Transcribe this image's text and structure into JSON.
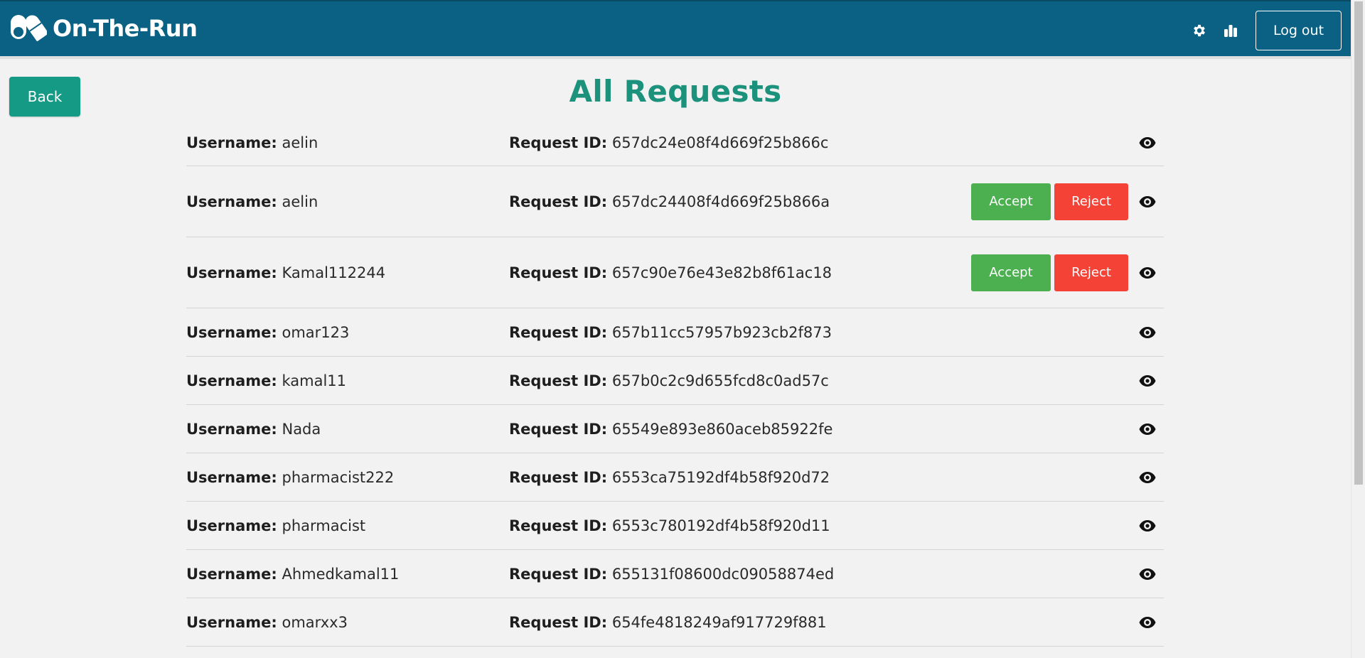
{
  "header": {
    "app_name": "On-The-Run",
    "logout_label": "Log out",
    "settings_icon": "gear-icon",
    "stats_icon": "bar-chart-icon",
    "logo_icon": "pill-capsule-icon"
  },
  "back_label": "Back",
  "page_title": "All Requests",
  "labels": {
    "username": "Username:",
    "request_id": "Request ID:",
    "accept": "Accept",
    "reject": "Reject"
  },
  "requests": [
    {
      "username": "aelin",
      "request_id": "657dc24e08f4d669f25b866c",
      "pending": false
    },
    {
      "username": "aelin",
      "request_id": "657dc24408f4d669f25b866a",
      "pending": true
    },
    {
      "username": "Kamal112244",
      "request_id": "657c90e76e43e82b8f61ac18",
      "pending": true
    },
    {
      "username": "omar123",
      "request_id": "657b11cc57957b923cb2f873",
      "pending": false
    },
    {
      "username": "kamal11",
      "request_id": "657b0c2c9d655fcd8c0ad57c",
      "pending": false
    },
    {
      "username": "Nada",
      "request_id": "65549e893e860aceb85922fe",
      "pending": false
    },
    {
      "username": "pharmacist222",
      "request_id": "6553ca75192df4b58f920d72",
      "pending": false
    },
    {
      "username": "pharmacist",
      "request_id": "6553c780192df4b58f920d11",
      "pending": false
    },
    {
      "username": "Ahmedkamal11",
      "request_id": "655131f08600dc09058874ed",
      "pending": false
    },
    {
      "username": "omarxx3",
      "request_id": "654fe4818249af917729f881",
      "pending": false
    }
  ],
  "colors": {
    "header_bg": "#0a6183",
    "title": "#1c927c",
    "back_button": "#159a85",
    "accept": "#4caf50",
    "reject": "#f44336"
  }
}
